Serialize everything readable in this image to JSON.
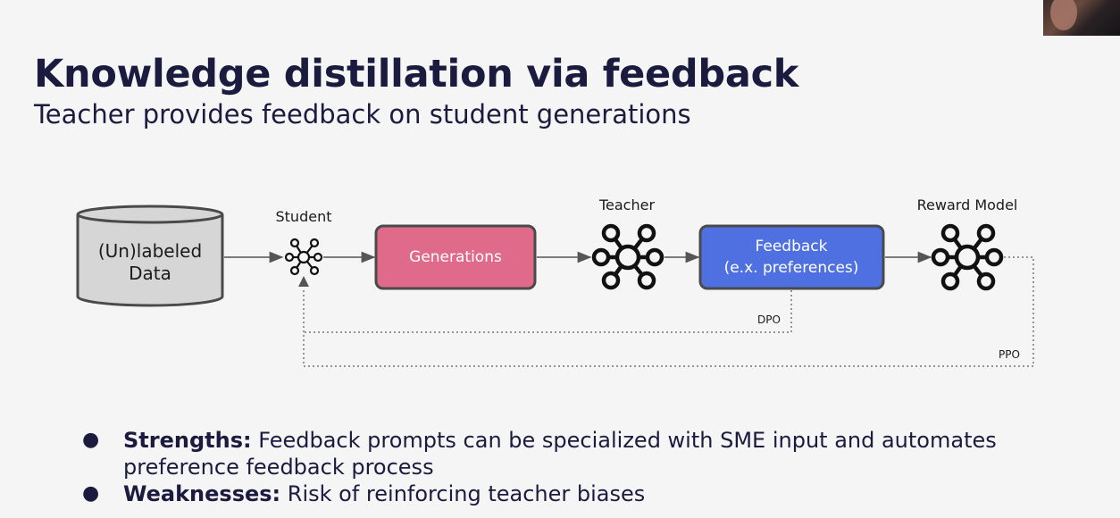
{
  "title": "Knowledge distillation via feedback",
  "subtitle": "Teacher provides feedback on student generations",
  "diagram": {
    "data_store": {
      "line1": "(Un)labeled",
      "line2": "Data"
    },
    "student_label": "Student",
    "generations_label": "Generations",
    "teacher_label": "Teacher",
    "feedback": {
      "line1": "Feedback",
      "line2": "(e.x. preferences)"
    },
    "reward_model_label": "Reward Model",
    "dpo_label": "DPO",
    "ppo_label": "PPO",
    "colors": {
      "generations_fill": "#e06a89",
      "feedback_fill": "#4f70e0",
      "box_border": "#4a4a4a",
      "icon": "#111111"
    }
  },
  "bullets": [
    {
      "heading": "Strengths:",
      "text": " Feedback prompts can be specialized with SME input and automates preference feedback process"
    },
    {
      "heading": "Weaknesses:",
      "text": " Risk of reinforcing teacher biases"
    }
  ]
}
